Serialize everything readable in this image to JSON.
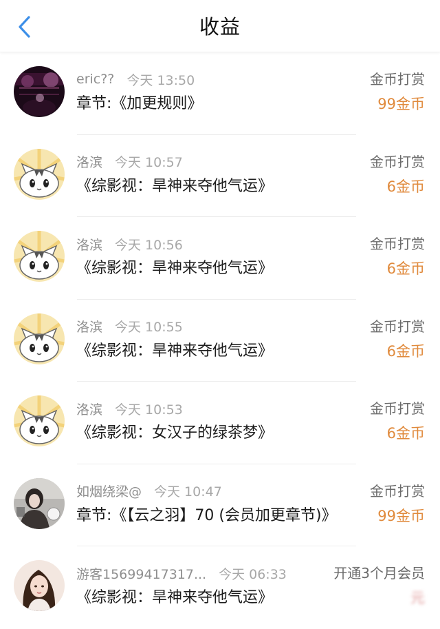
{
  "header": {
    "title": "收益",
    "back_icon": "chevron-left-icon",
    "accent": "#3d8fe8"
  },
  "colors": {
    "amount": "#e08a3c",
    "muted": "#8f8f8f",
    "text": "#1c1c1c"
  },
  "records": [
    {
      "user": "eric??",
      "time": "今天 13:50",
      "type": "金币打赏",
      "desc": "章节:《加更规则》",
      "amount": "99金币",
      "avatar": "dark-concert-photo"
    },
    {
      "user": "洛滨",
      "time": "今天 10:57",
      "type": "金币打赏",
      "desc": "《综影视：旱神来夺他气运》",
      "amount": "6金币",
      "avatar": "cartoon-cat"
    },
    {
      "user": "洛滨",
      "time": "今天 10:56",
      "type": "金币打赏",
      "desc": "《综影视：旱神来夺他气运》",
      "amount": "6金币",
      "avatar": "cartoon-cat"
    },
    {
      "user": "洛滨",
      "time": "今天 10:55",
      "type": "金币打赏",
      "desc": "《综影视：旱神来夺他气运》",
      "amount": "6金币",
      "avatar": "cartoon-cat"
    },
    {
      "user": "洛滨",
      "time": "今天 10:53",
      "type": "金币打赏",
      "desc": "《综影视：女汉子的绿茶梦》",
      "amount": "6金币",
      "avatar": "cartoon-cat"
    },
    {
      "user": "如烟绕梁@",
      "time": "今天 10:47",
      "type": "金币打赏",
      "desc": "章节:《【云之羽】70 (会员加更章节)》",
      "amount": "99金币",
      "avatar": "portrait-photo-dark"
    },
    {
      "user": "游客15699417317...",
      "time": "今天 06:33",
      "type": "开通3个月会员",
      "desc": "《综影视：旱神来夺他气运》",
      "amount": "元",
      "avatar": "portrait-photo-girl"
    }
  ]
}
